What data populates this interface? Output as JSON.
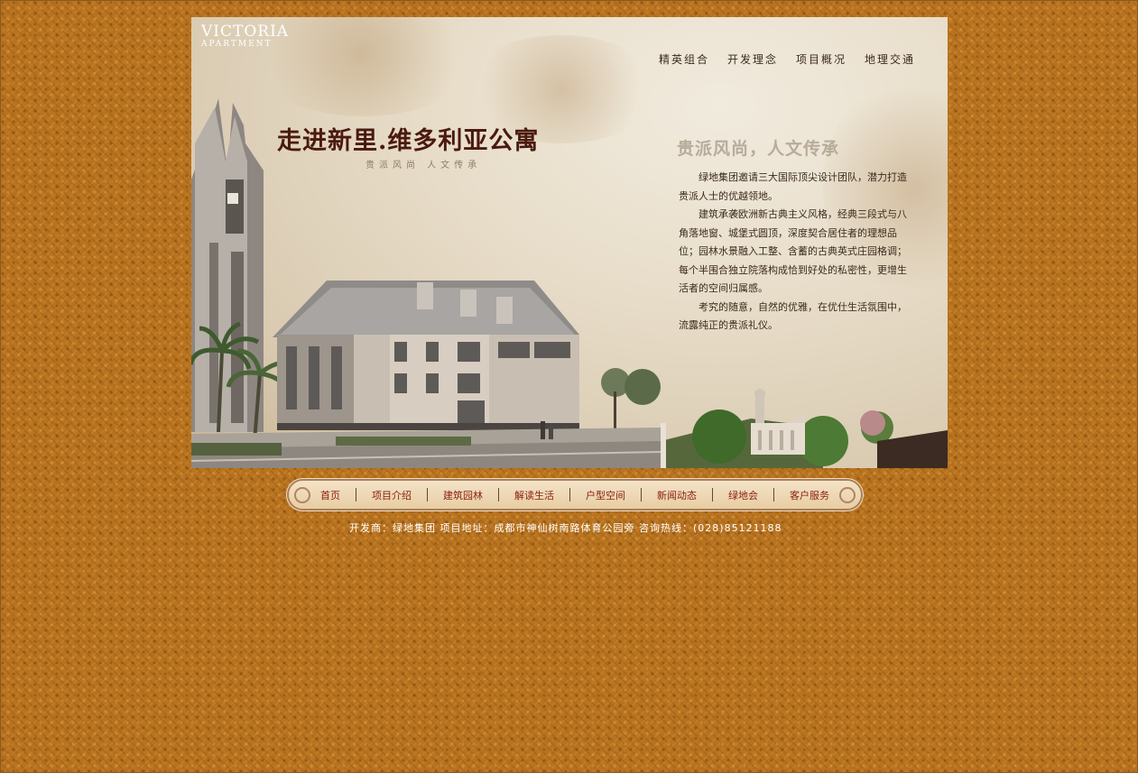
{
  "banner": {
    "logo_line1": "VICTORIA",
    "logo_line2": "APARTMENT",
    "top_nav": [
      "精英组合",
      "开发理念",
      "项目概况",
      "地理交通"
    ],
    "headline": "走进新里.维多利亚公寓",
    "subheadline": "贵派风尚  人文传承",
    "slogan": "贵派风尚，人文传承",
    "paragraphs": [
      "绿地集团邀请三大国际顶尖设计团队，潜力打造贵派人士的优越领地。",
      "建筑承袭欧洲新古典主义风格，经典三段式与八角落地窗、城堡式圆顶，深度契合居住者的理想品位；园林水景融入工整、含蓄的古典英式庄园格调；每个半围合独立院落构成恰到好处的私密性，更增生活者的空间归属感。",
      "考究的随意，自然的优雅，在优仕生活氛围中，流露纯正的贵派礼仪。"
    ]
  },
  "main_nav": {
    "items": [
      "首页",
      "项目介绍",
      "建筑园林",
      "解读生活",
      "户型空间",
      "新闻动态",
      "绿地会",
      "客户服务"
    ]
  },
  "footer": {
    "text": "开发商：绿地集团   项目地址：成都市神仙树南路体育公园旁    咨询热线：(028)85121188"
  },
  "colors": {
    "background": "#b8731f",
    "nav_text": "#8a1f0e",
    "headline": "#4a1a0f"
  }
}
